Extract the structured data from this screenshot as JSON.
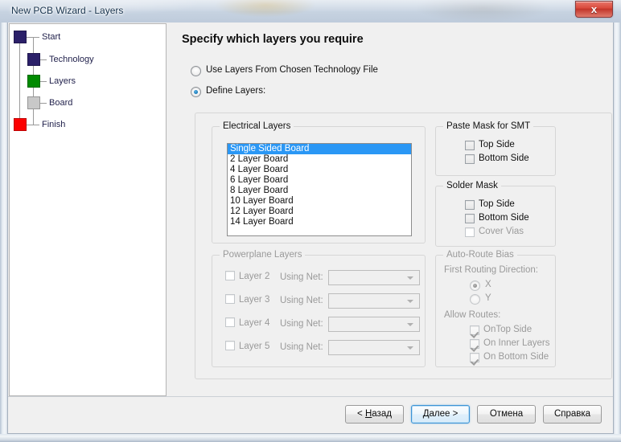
{
  "window": {
    "title": "New PCB Wizard - Layers",
    "close_glyph": "x"
  },
  "sidebar": {
    "items": [
      {
        "label": "Start",
        "color": "#2b2069"
      },
      {
        "label": "Technology",
        "color": "#2b2069"
      },
      {
        "label": "Layers",
        "color": "#008a00"
      },
      {
        "label": "Board",
        "color": "#c8c8c8"
      },
      {
        "label": "Finish",
        "color": "#fc0000"
      }
    ]
  },
  "content": {
    "page_title": "Specify which layers you require",
    "mode_options": [
      {
        "label": "Use Layers From Chosen Technology File",
        "selected": false,
        "disabled": false
      },
      {
        "label": "Define Layers:",
        "selected": true,
        "disabled": false
      }
    ],
    "electrical_layers": {
      "title": "Electrical Layers",
      "items": [
        "Single Sided Board",
        "2 Layer Board",
        "4 Layer Board",
        "6 Layer Board",
        "8 Layer Board",
        "10 Layer Board",
        "12 Layer Board",
        "14 Layer Board"
      ],
      "selected_index": 0,
      "selection_color": "#2a97f5"
    },
    "powerplane_layers": {
      "title": "Powerplane Layers",
      "disabled": true,
      "net_label": "Using Net:",
      "rows": [
        {
          "label": "Layer 2",
          "checked": false,
          "net_value": ""
        },
        {
          "label": "Layer 3",
          "checked": false,
          "net_value": ""
        },
        {
          "label": "Layer 4",
          "checked": false,
          "net_value": ""
        },
        {
          "label": "Layer 5",
          "checked": false,
          "net_value": ""
        }
      ]
    },
    "paste_mask": {
      "title": "Paste Mask for SMT",
      "items": [
        {
          "label": "Top Side",
          "checked": false,
          "disabled": false
        },
        {
          "label": "Bottom Side",
          "checked": false,
          "disabled": false
        }
      ]
    },
    "solder_mask": {
      "title": "Solder Mask",
      "items": [
        {
          "label": "Top Side",
          "checked": false,
          "disabled": false
        },
        {
          "label": "Bottom Side",
          "checked": false,
          "disabled": false
        },
        {
          "label": "Cover Vias",
          "checked": false,
          "disabled": true
        }
      ]
    },
    "auto_route_bias": {
      "title": "Auto-Route Bias",
      "direction_label": "First Routing Direction:",
      "directions": [
        {
          "label": "X",
          "selected": true
        },
        {
          "label": "Y",
          "selected": false
        }
      ],
      "allow_label": "Allow Routes:",
      "allow_routes": [
        {
          "label": "OnTop Side",
          "checked": true
        },
        {
          "label": "On Inner Layers",
          "checked": true
        },
        {
          "label": "On Bottom Side",
          "checked": true
        }
      ],
      "disabled": true
    }
  },
  "footer": {
    "buttons": [
      {
        "name": "back",
        "prefix": "< ",
        "accel": "Н",
        "suffix": "азад",
        "default": false
      },
      {
        "name": "next",
        "prefix": "",
        "accel": "",
        "suffix": "Далее >",
        "default": true
      },
      {
        "name": "cancel",
        "prefix": "",
        "accel": "",
        "suffix": "Отмена",
        "default": false
      },
      {
        "name": "help",
        "prefix": "",
        "accel": "",
        "suffix": "Справка",
        "default": false
      }
    ]
  }
}
